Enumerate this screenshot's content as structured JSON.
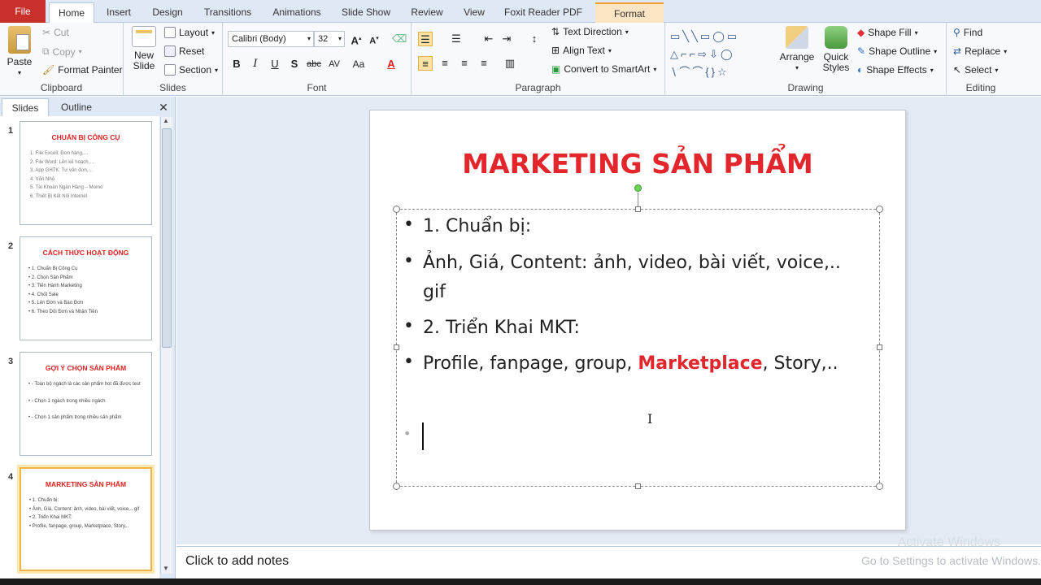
{
  "tabs": [
    "File",
    "Home",
    "Insert",
    "Design",
    "Transitions",
    "Animations",
    "Slide Show",
    "Review",
    "View",
    "Foxit Reader PDF",
    "Format"
  ],
  "clipboard": {
    "paste": "Paste",
    "cut": "Cut",
    "copy": "Copy",
    "format_painter": "Format Painter",
    "label": "Clipboard"
  },
  "slides_group": {
    "new_slide": "New Slide",
    "layout": "Layout",
    "reset": "Reset",
    "section": "Section",
    "label": "Slides"
  },
  "font": {
    "name": "Calibri (Body)",
    "size": "32",
    "label": "Font"
  },
  "paragraph": {
    "text_direction": "Text Direction",
    "align_text": "Align Text",
    "convert_smartart": "Convert to SmartArt",
    "label": "Paragraph"
  },
  "drawing": {
    "arrange": "Arrange",
    "quick_styles": "Quick Styles",
    "shape_fill": "Shape Fill",
    "shape_outline": "Shape Outline",
    "shape_effects": "Shape Effects",
    "label": "Drawing"
  },
  "editing": {
    "find": "Find",
    "replace": "Replace",
    "select": "Select",
    "label": "Editing"
  },
  "pane_tabs": {
    "slides": "Slides",
    "outline": "Outline"
  },
  "thumbnails": [
    {
      "num": "1",
      "title": "CHUẨN BỊ CÔNG CỤ",
      "lines": [
        "1.  File Excell: Đơn hàng,…",
        "2.  File Word: Lên kế hoạch,…",
        "3.  App GHTK: Tư vấn đơn,…",
        "4.  Vốn Nhỏ",
        "5.  Tài Khoản Ngân Hàng – Momo",
        "6.  Thiết Bị Kết Nối Internet"
      ]
    },
    {
      "num": "2",
      "title": "CÁCH THỨC HOẠT ĐỘNG",
      "lines": [
        "•  1. Chuẩn Bị Công Cụ",
        "•  2. Chọn Sản Phẩm",
        "•  3. Tiến Hành Marketing",
        "•  4. Chốt Sale",
        "•  5. Lên Đơn và Báo Đơn",
        "•  6. Theo Dõi Đơn và Nhận Tiền"
      ]
    },
    {
      "num": "3",
      "title": "GỢI Ý CHỌN SẢN PHẨM",
      "lines": [
        "•  - Toàn bộ ngách là các sản phẩm hot đã được test",
        "",
        "•  - Chọn 1 ngách trong nhiều ngách",
        "",
        "•  - Chọn 1 sản phẩm trong nhiều sản phẩm"
      ]
    },
    {
      "num": "4",
      "title": "MARKETING SẢN PHẨM",
      "lines": [
        "•  1. Chuẩn bị:",
        "•  Ảnh, Giá, Content: ảnh, video, bài viết, voice,.. gif",
        "•  2. Triển Khai MKT:",
        "•  Profile, fanpage, group, Marketplace, Story,.."
      ]
    }
  ],
  "slide": {
    "title": "MARKETING SẢN PHẨM",
    "bullets": {
      "b1": "1. Chuẩn bị:",
      "b2a": "Ảnh, Giá, Content: ảnh, video, bài viết, voice,..",
      "b2b": "gif",
      "b3": "2. Triển Khai MKT:",
      "b4a": "Profile, fanpage, group, ",
      "b4b": "Marketplace",
      "b4c": ", Story,.."
    }
  },
  "notes": {
    "placeholder": "Click to add notes"
  },
  "watermark": {
    "line1": "Activate Windows",
    "line2": "Go to Settings to activate Windows."
  },
  "colors": {
    "accent_red": "#e3262b",
    "file_tab": "#c9302c",
    "selection": "#f0b54a"
  }
}
